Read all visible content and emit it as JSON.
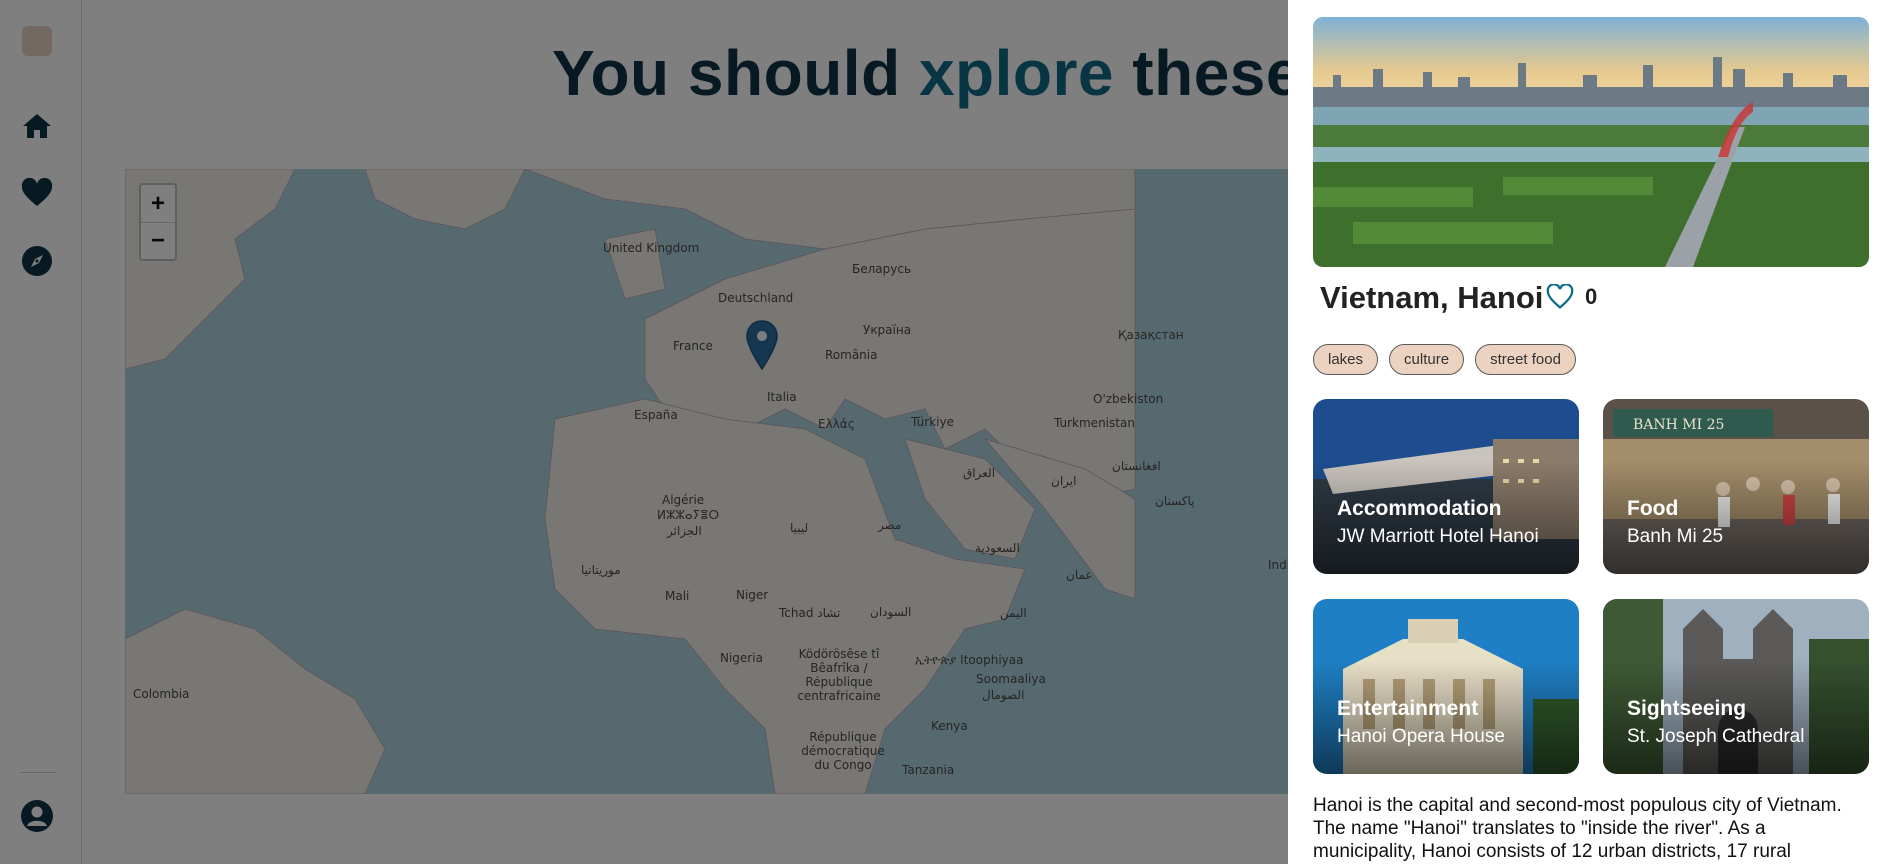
{
  "nav": {
    "items": [
      {
        "name": "home",
        "icon": "home-icon"
      },
      {
        "name": "favorites",
        "icon": "heart-icon"
      },
      {
        "name": "explore",
        "icon": "compass-icon"
      }
    ],
    "profile_icon": "user-icon"
  },
  "page": {
    "title_pre": "You should ",
    "title_accent": "xplore",
    "title_post": " these places"
  },
  "map": {
    "zoom_in": "+",
    "zoom_out": "−",
    "labels": [
      "United Kingdom",
      "Беларусь",
      "Deutschland",
      "France",
      "Україна",
      "Қазақстан",
      "România",
      "Italia",
      "España",
      "Ελλάς",
      "Türkiye",
      "O'zbekiston",
      "Turkmenistan",
      "Algérie",
      "ⵍⵣⵣⴰⵢⴻⵔ",
      "الجزائر",
      "ليبيا",
      "مصر",
      "العراق",
      "ايران",
      "افغانستان",
      "پاکستان",
      "السعودية",
      "عمان",
      "India",
      "موريتانيا",
      "Mali",
      "Niger",
      "Tchad تشاد",
      "السودان",
      "اليمن",
      "Nigeria",
      "Ködörösêse tî Bêafrîka / République centrafricaine",
      "ኢትዮጵያ Itoophiyaa",
      "Soomaaliya",
      "الصومال",
      "Kenya",
      "République démocratique du Congo",
      "Tanzania",
      "Colombia"
    ]
  },
  "drawer": {
    "title": "Vietnam, Hanoi",
    "favorite_count": "0",
    "tags": [
      "lakes",
      "culture",
      "street food"
    ],
    "cards": [
      {
        "category": "Accommodation",
        "place": "JW Marriott Hotel Hanoi"
      },
      {
        "category": "Food",
        "place": "Banh Mi 25"
      },
      {
        "category": "Entertainment",
        "place": "Hanoi Opera House"
      },
      {
        "category": "Sightseeing",
        "place": "St. Joseph Cathedral"
      }
    ],
    "description": "Hanoi is the capital and second-most populous city of Vietnam. The name \"Hanoi\" translates to \"inside the river\". As a municipality, Hanoi consists of 12 urban districts, 17 rural"
  },
  "colors": {
    "brand_dark": "#0f3446",
    "accent": "#0e6b88",
    "tag_bg": "#ecd3c1",
    "overlay": "rgba(0,0,0,0.5)"
  }
}
